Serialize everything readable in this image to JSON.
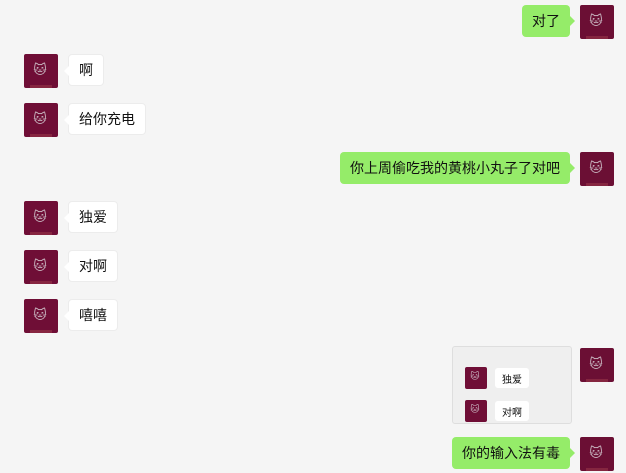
{
  "messages": [
    {
      "side": "sent",
      "text": "对了"
    },
    {
      "side": "recv",
      "text": "啊"
    },
    {
      "side": "recv",
      "text": "给你充电"
    },
    {
      "side": "sent",
      "text": "你上周偷吃我的黄桃小丸子了对吧"
    },
    {
      "side": "recv",
      "text": "独爱"
    },
    {
      "side": "recv",
      "text": "对啊"
    },
    {
      "side": "recv",
      "text": "嘻嘻"
    },
    {
      "side": "sent",
      "text": "你的输入法有毒"
    }
  ],
  "forwarded_card": {
    "items": [
      {
        "text": "独爱"
      },
      {
        "text": "对啊"
      }
    ]
  },
  "avatar": {
    "icon": "cat-avatar-icon",
    "glyph": "🐱",
    "color": "#6f0e36"
  },
  "colors": {
    "background": "#f5f5f5",
    "sent_bubble": "#95ec69",
    "recv_bubble": "#ffffff"
  }
}
